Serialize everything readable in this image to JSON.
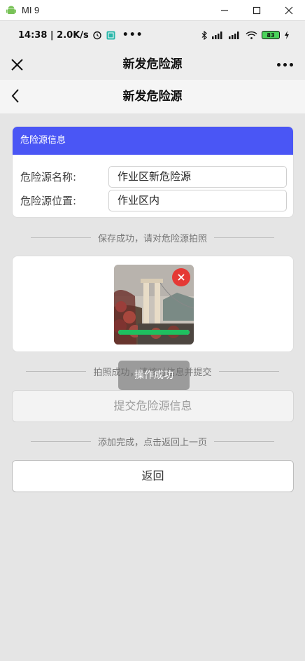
{
  "window": {
    "title": "MI 9"
  },
  "status_bar": {
    "time_speed": "14:38 | 2.0K/s",
    "battery": "83"
  },
  "nav": {
    "title": "新发危险源"
  },
  "page": {
    "title": "新发危险源"
  },
  "info_card": {
    "header": "危险源信息",
    "fields": [
      {
        "label": "危险源名称:",
        "value": "作业区新危险源"
      },
      {
        "label": "危险源位置:",
        "value": "作业区内"
      }
    ]
  },
  "messages": {
    "saved": "保存成功，请对危险源拍照",
    "photo_done": "拍照成功，请核对信息并提交",
    "added": "添加完成，点击返回上一页"
  },
  "photo": {
    "upload_progress": 1.0
  },
  "buttons": {
    "submit": "提交危险源信息",
    "back": "返回"
  },
  "toast": {
    "text": "操作成功"
  },
  "colors": {
    "accent": "#4a56f5",
    "delete": "#e53935",
    "progress": "#1fbf5f"
  }
}
